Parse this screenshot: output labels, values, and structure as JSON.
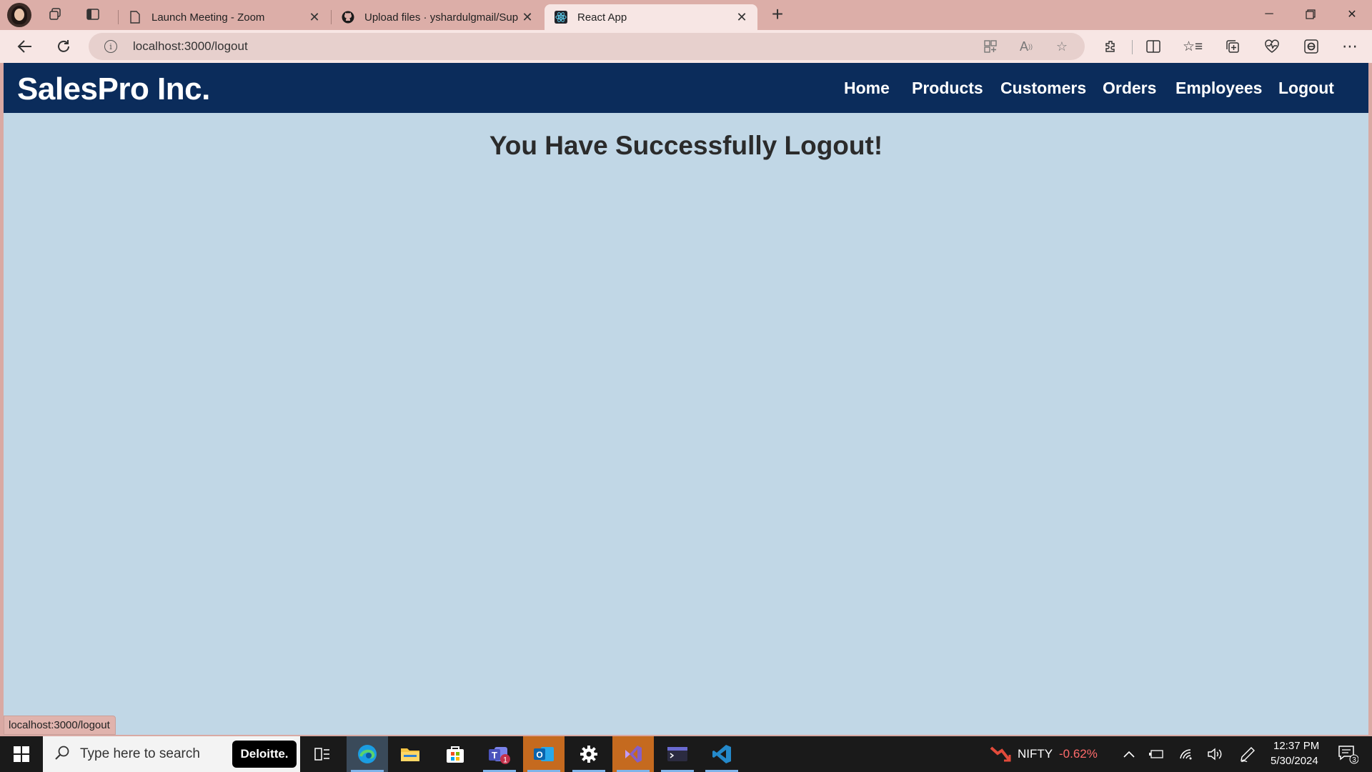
{
  "browser": {
    "tabs": [
      {
        "title": "Launch Meeting - Zoom",
        "active": false
      },
      {
        "title": "Upload files · yshardulgmail/Sup",
        "active": false
      },
      {
        "title": "React App",
        "active": true
      }
    ],
    "url": "localhost:3000/logout"
  },
  "app": {
    "brand": "SalesPro Inc.",
    "nav": [
      "Home",
      "Products",
      "Customers",
      "Orders",
      "Employees",
      "Logout"
    ],
    "heading": "You Have Successfully Logout!"
  },
  "status_bar": {
    "url": "localhost:3000/logout"
  },
  "taskbar": {
    "search_placeholder": "Type here to search",
    "deloitte_label": "Deloitte.",
    "teams_badge": "1",
    "nifty_label": "NIFTY",
    "nifty_change": "-0.62%",
    "time": "12:37 PM",
    "date": "5/30/2024",
    "notification_count": "3"
  },
  "colors": {
    "navbar": "#0b2c5b",
    "page_background": "#c1d7e6",
    "tab_strip": "#dcaea8",
    "nifty_negative": "#ff6b6b"
  }
}
